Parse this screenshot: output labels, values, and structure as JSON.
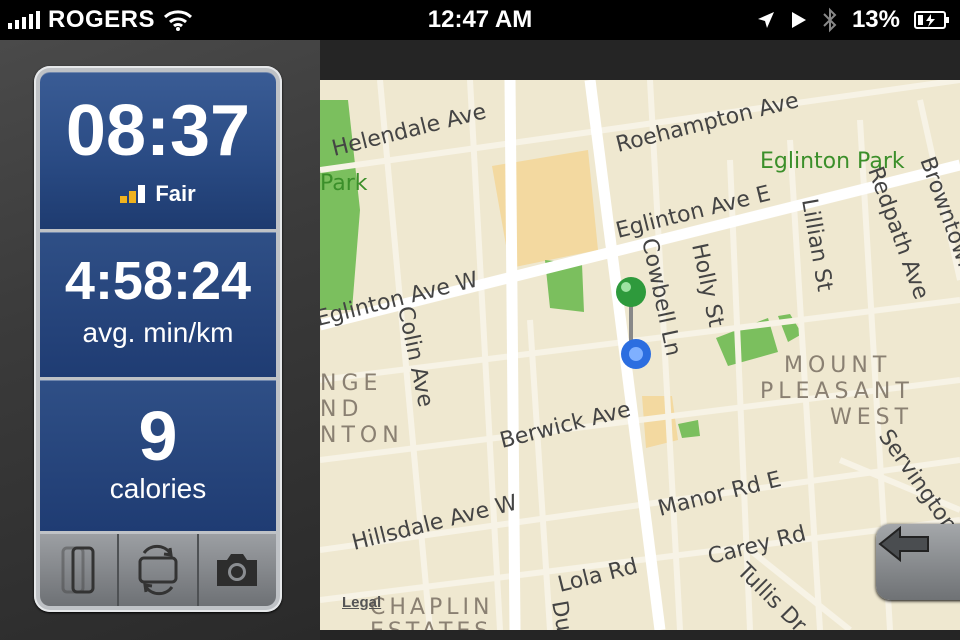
{
  "status_bar": {
    "carrier": "ROGERS",
    "time": "12:47 AM",
    "battery": "13%"
  },
  "workout": {
    "duration": "08:37",
    "gps_label": "Fair",
    "pace": "4:58:24",
    "pace_unit": "avg. min/km",
    "calories": "9",
    "calories_unit": "calories"
  },
  "toolbar": {
    "icons": [
      "lock-screen-icon",
      "switch-view-icon",
      "camera-icon"
    ]
  },
  "map": {
    "legal": "Legal",
    "streets": [
      "Helendale Ave",
      "Roehampton Ave",
      "Eglinton Park",
      "Park",
      "Browntown",
      "Eglinton Ave E",
      "Redpath Ave",
      "Lillian St",
      "Holly St",
      "Cowbell Ln",
      "Eglinton Ave W",
      "Colin Ave",
      "MOUNT",
      "PLEASANT",
      "WEST",
      "NGE",
      "ND",
      "NTON",
      "Berwick Ave",
      "Servington",
      "Hillsdale Ave W",
      "Manor Rd E",
      "Carey Rd",
      "Lola Rd",
      "Tullis Dr",
      "CHAPLIN",
      "ESTATES",
      "Du"
    ]
  },
  "colors": {
    "card_blue": "#24427a",
    "map_bg": "#efe8d0",
    "park_green": "#7bbf5e",
    "pin_green": "#2e9a3c",
    "location_blue": "#2c6ee0"
  }
}
